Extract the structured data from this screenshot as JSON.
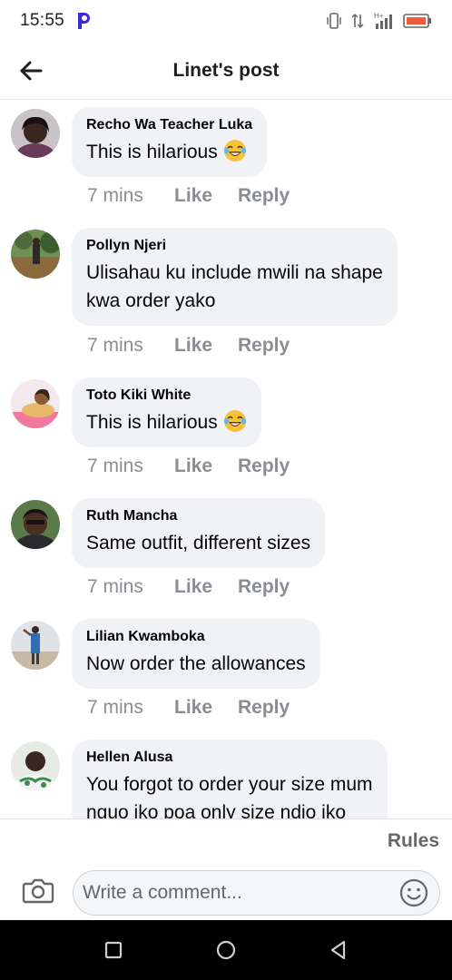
{
  "status_bar": {
    "time": "15:55",
    "signal_label": "H+"
  },
  "header": {
    "title": "Linet's post"
  },
  "comments": [
    {
      "author": "Recho Wa Teacher Luka",
      "text": "This is hilarious",
      "emoji": "laughing-tears",
      "time": "7 mins",
      "like": "Like",
      "reply": "Reply"
    },
    {
      "author": "Pollyn Njeri",
      "text_lines": [
        "Ulisahau ku include mwili na shape",
        "kwa order yako"
      ],
      "time": "7 mins",
      "like": "Like",
      "reply": "Reply"
    },
    {
      "author": "Toto Kiki White",
      "text": "This is hilarious",
      "emoji": "laughing-tears",
      "time": "7 mins",
      "like": "Like",
      "reply": "Reply"
    },
    {
      "author": "Ruth Mancha",
      "text": "Same outfit, different sizes",
      "time": "7 mins",
      "like": "Like",
      "reply": "Reply"
    },
    {
      "author": "Lilian Kwamboka",
      "text": "Now order the allowances",
      "time": "7 mins",
      "like": "Like",
      "reply": "Reply"
    },
    {
      "author": "Hellen Alusa",
      "text_lines": [
        "You forgot to order your size mum",
        "nguo iko poa only size ndio iko"
      ]
    }
  ],
  "composer": {
    "rules_label": "Rules",
    "placeholder": "Write a comment..."
  },
  "colors": {
    "bubble": "#f0f2f5",
    "muted": "#8a8d91",
    "accent_app": "#3b2bd6"
  }
}
